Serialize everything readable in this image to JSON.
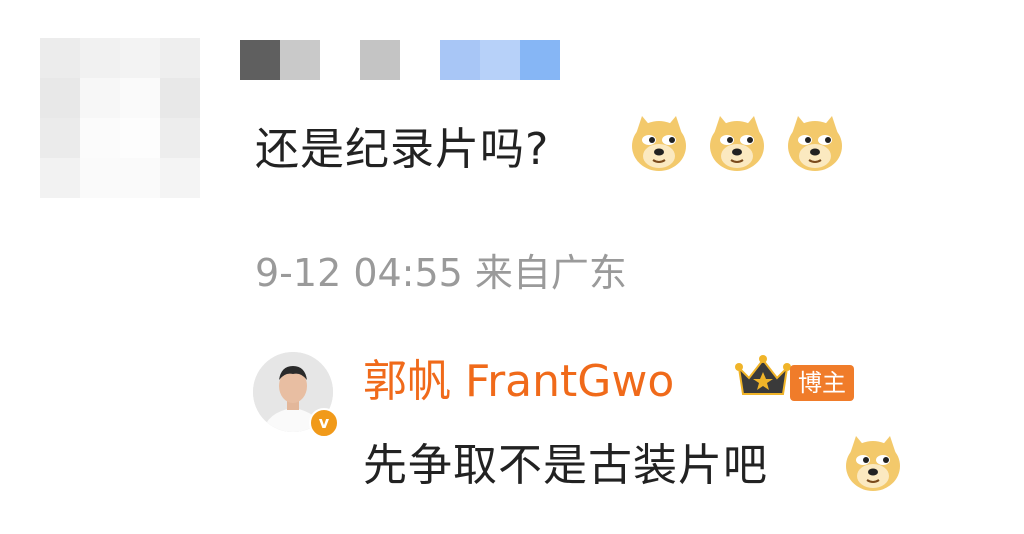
{
  "colors": {
    "username_orange": "#f06a1a",
    "badge_bg": "#f07c2a",
    "verified_badge": "#f19a1a",
    "meta_gray": "#9a9a9a",
    "text_dark": "#222222"
  },
  "comment": {
    "author_blurred": true,
    "text": "还是纪录片吗?",
    "emojis": [
      "doge-emoji",
      "doge-emoji",
      "doge-emoji"
    ],
    "meta": "9-12 04:55 来自广东"
  },
  "reply": {
    "username": "郭帆 FrantGwo",
    "crown_icon": "crown-icon",
    "badge": "博主",
    "verified_icon": "verified-v-icon",
    "verified_mark": "v",
    "text": "先争取不是古装片吧",
    "emoji": "doge-emoji"
  }
}
